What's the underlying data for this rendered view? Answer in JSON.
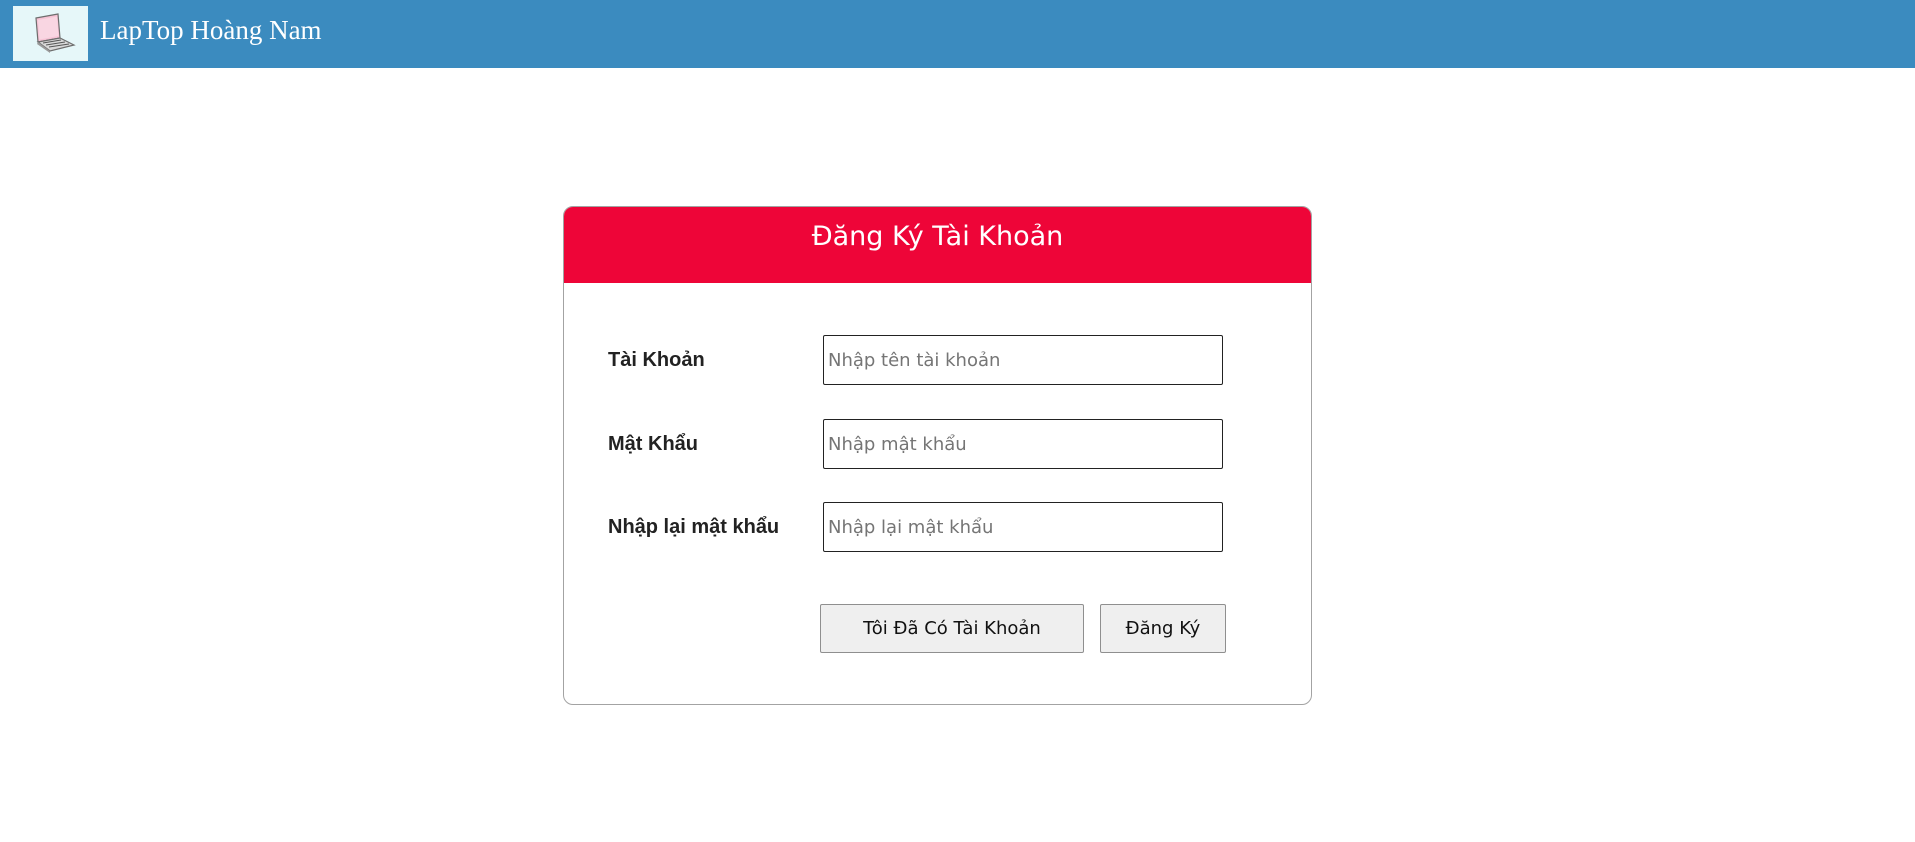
{
  "header": {
    "brand": "LapTop Hoàng Nam",
    "logo_icon": "laptop-icon"
  },
  "form": {
    "title": "Đăng Ký Tài Khoản",
    "fields": [
      {
        "label": "Tài Khoản",
        "placeholder": "Nhập tên tài khoản",
        "value": ""
      },
      {
        "label": "Mật Khẩu",
        "placeholder": "Nhập mật khẩu",
        "value": ""
      },
      {
        "label": "Nhập lại mật khẩu",
        "placeholder": "Nhập lại mật khẩu",
        "value": ""
      }
    ],
    "buttons": {
      "have_account": "Tôi Đã Có Tài Khoản",
      "register": "Đăng Ký"
    }
  },
  "colors": {
    "topbar": "#3b8bbf",
    "card_header": "#ee0538"
  }
}
